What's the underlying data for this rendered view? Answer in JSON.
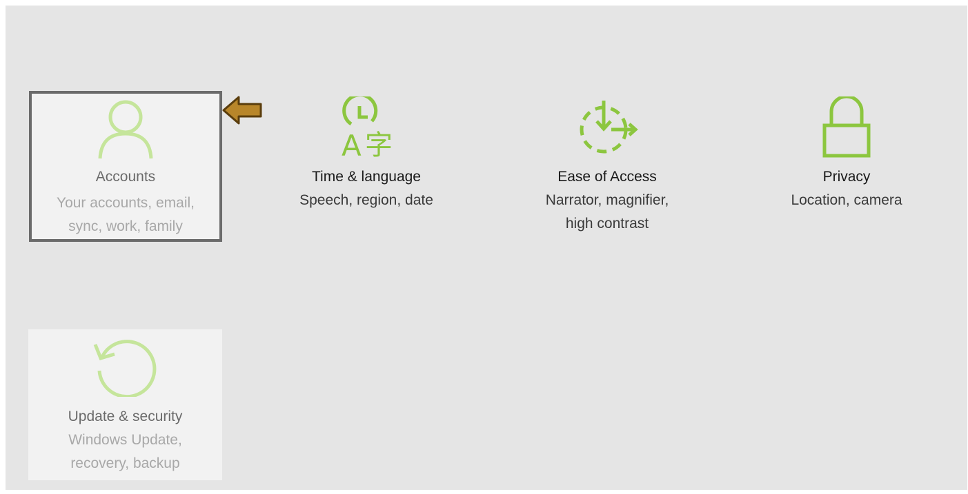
{
  "accent_color": "#8cc63f",
  "faded_accent_color": "#c5e59b",
  "pointer_color": "#b8862a",
  "tiles": [
    {
      "icon": "person-icon",
      "title": "Accounts",
      "description": "Your accounts, email,\nsync, work, family",
      "state": "selected"
    },
    {
      "icon": "time-language-icon",
      "title": "Time & language",
      "description": "Speech, region, date",
      "state": "normal"
    },
    {
      "icon": "ease-of-access-icon",
      "title": "Ease of Access",
      "description": "Narrator, magnifier,\nhigh contrast",
      "state": "normal"
    },
    {
      "icon": "lock-icon",
      "title": "Privacy",
      "description": "Location, camera",
      "state": "normal"
    },
    {
      "icon": "update-icon",
      "title": "Update & security",
      "description": "Windows Update,\nrecovery, backup",
      "state": "hover"
    }
  ],
  "annotation": {
    "icon": "pointer-arrow-icon"
  }
}
